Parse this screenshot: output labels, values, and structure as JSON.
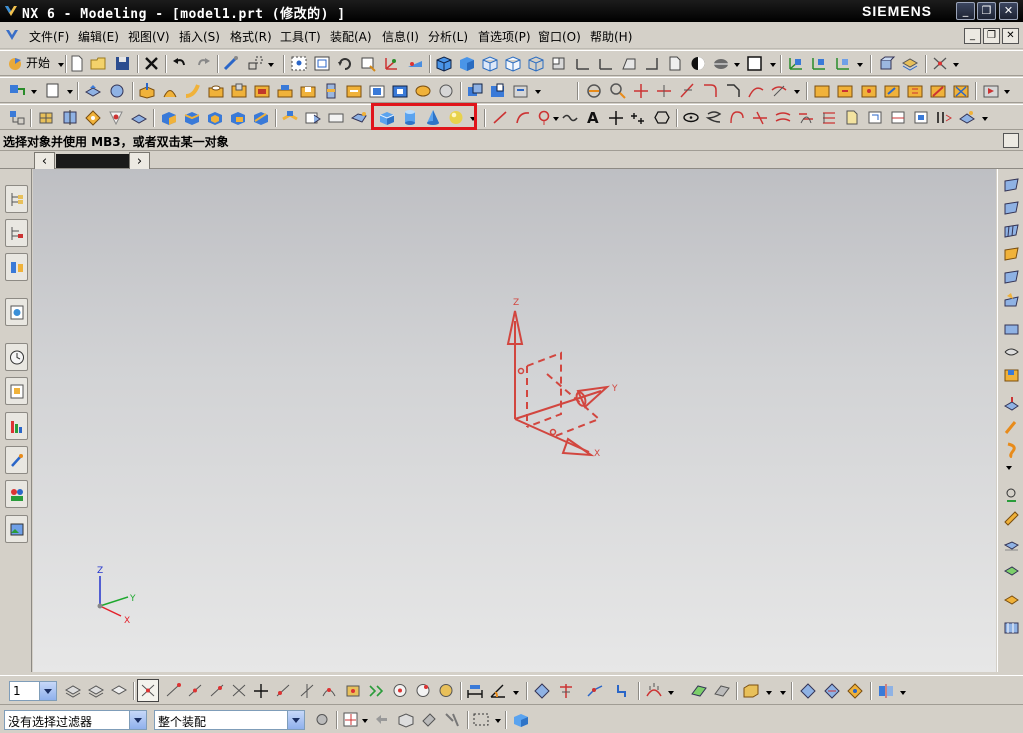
{
  "window": {
    "title": "NX 6 - Modeling - [model1.prt  (修改的) ]",
    "brand": "SIEMENS",
    "minimize": "_",
    "restore": "❐",
    "close": "✕"
  },
  "menubar": {
    "items": [
      "文件(F)",
      "编辑(E)",
      "视图(V)",
      "插入(S)",
      "格式(R)",
      "工具(T)",
      "装配(A)",
      "信息(I)",
      "分析(L)",
      "首选项(P)",
      "窗口(O)",
      "帮助(H)"
    ],
    "mdi_minimize": "_",
    "mdi_restore": "❐",
    "mdi_close": "✕"
  },
  "toolbar": {
    "start_label": "开始",
    "highlighted_icons": [
      "block-icon",
      "cylinder-icon",
      "cone-icon",
      "sphere-icon"
    ]
  },
  "prompt": {
    "text": "选择对象并使用 MB3，或者双击某一对象"
  },
  "viewport": {
    "triad_axes": [
      "Z",
      "Y",
      "X"
    ],
    "datum_axes": [
      "Z",
      "Y",
      "X"
    ],
    "datum_color": "#d2463f"
  },
  "bottombar": {
    "layer_value": "1"
  },
  "filterbar": {
    "selection_filter": "没有选择过滤器",
    "scope": "整个装配"
  },
  "colors": {
    "highlight": "#e0151b",
    "title_bg": "#000000",
    "chrome": "#d4d0c8"
  }
}
